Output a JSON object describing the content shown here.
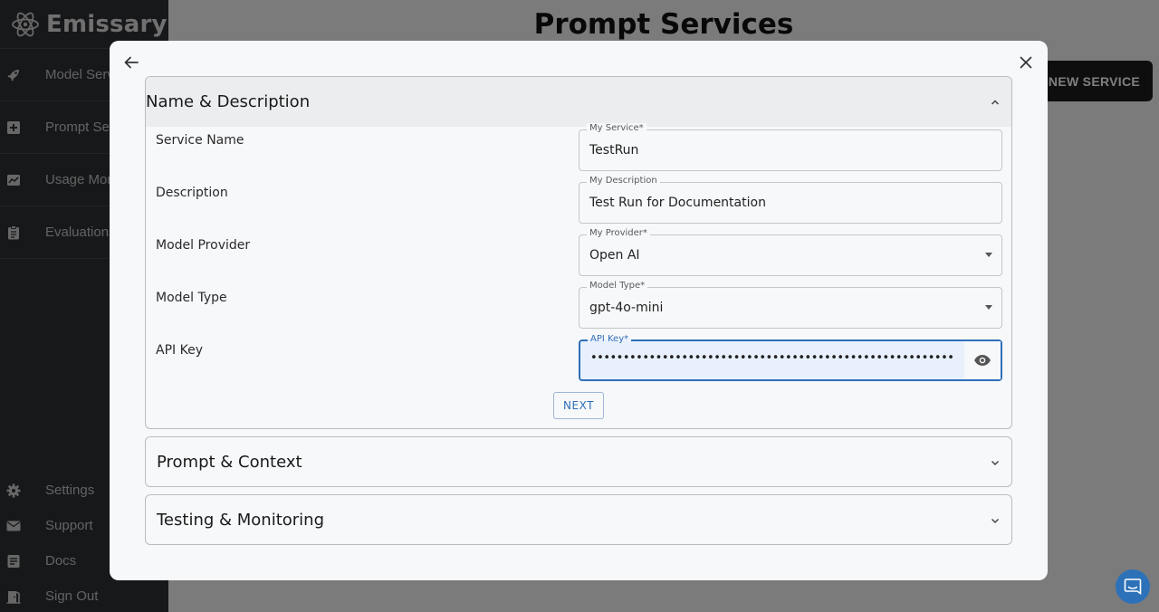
{
  "app": {
    "name": "Emissary"
  },
  "sidebar": {
    "items": [
      {
        "label": "Model Services",
        "icon": "rocket-icon"
      },
      {
        "label": "Prompt Services",
        "icon": "add-box-icon"
      },
      {
        "label": "Usage Monitoring",
        "icon": "monitor-chart-icon"
      },
      {
        "label": "Evaluations",
        "icon": "clipboard-icon"
      }
    ],
    "bottom_items": [
      {
        "label": "Settings",
        "icon": "gear-icon"
      },
      {
        "label": "Support",
        "icon": "mail-icon"
      },
      {
        "label": "Docs",
        "icon": "document-icon"
      },
      {
        "label": "Sign Out",
        "icon": "door-exit-icon"
      }
    ]
  },
  "header": {
    "title": "Prompt Services",
    "new_service_label": "+ NEW SERVICE"
  },
  "modal": {
    "sections": [
      {
        "title": "Name & Description",
        "expanded": true,
        "rows": [
          {
            "label": "Service Name",
            "field_label": "My Service*",
            "value": "TestRun",
            "type": "text"
          },
          {
            "label": "Description",
            "field_label": "My Description",
            "value": "Test Run for Documentation",
            "type": "text"
          },
          {
            "label": "Model Provider",
            "field_label": "My Provider*",
            "value": "Open AI",
            "type": "select"
          },
          {
            "label": "Model Type",
            "field_label": "Model Type*",
            "value": "gpt-4o-mini",
            "type": "select"
          },
          {
            "label": "API Key",
            "field_label": "API Key*",
            "value": "••••••••••••••••••••••••••••••••••••••••••••••••••••••••",
            "type": "password"
          }
        ],
        "next_label": "NEXT"
      },
      {
        "title": "Prompt & Context",
        "expanded": false
      },
      {
        "title": "Testing & Monitoring",
        "expanded": false
      }
    ]
  },
  "colors": {
    "sidebar_bg": "#2e3034",
    "accent": "#2f6fb8",
    "focused_field_bg": "#e8f0fd"
  }
}
